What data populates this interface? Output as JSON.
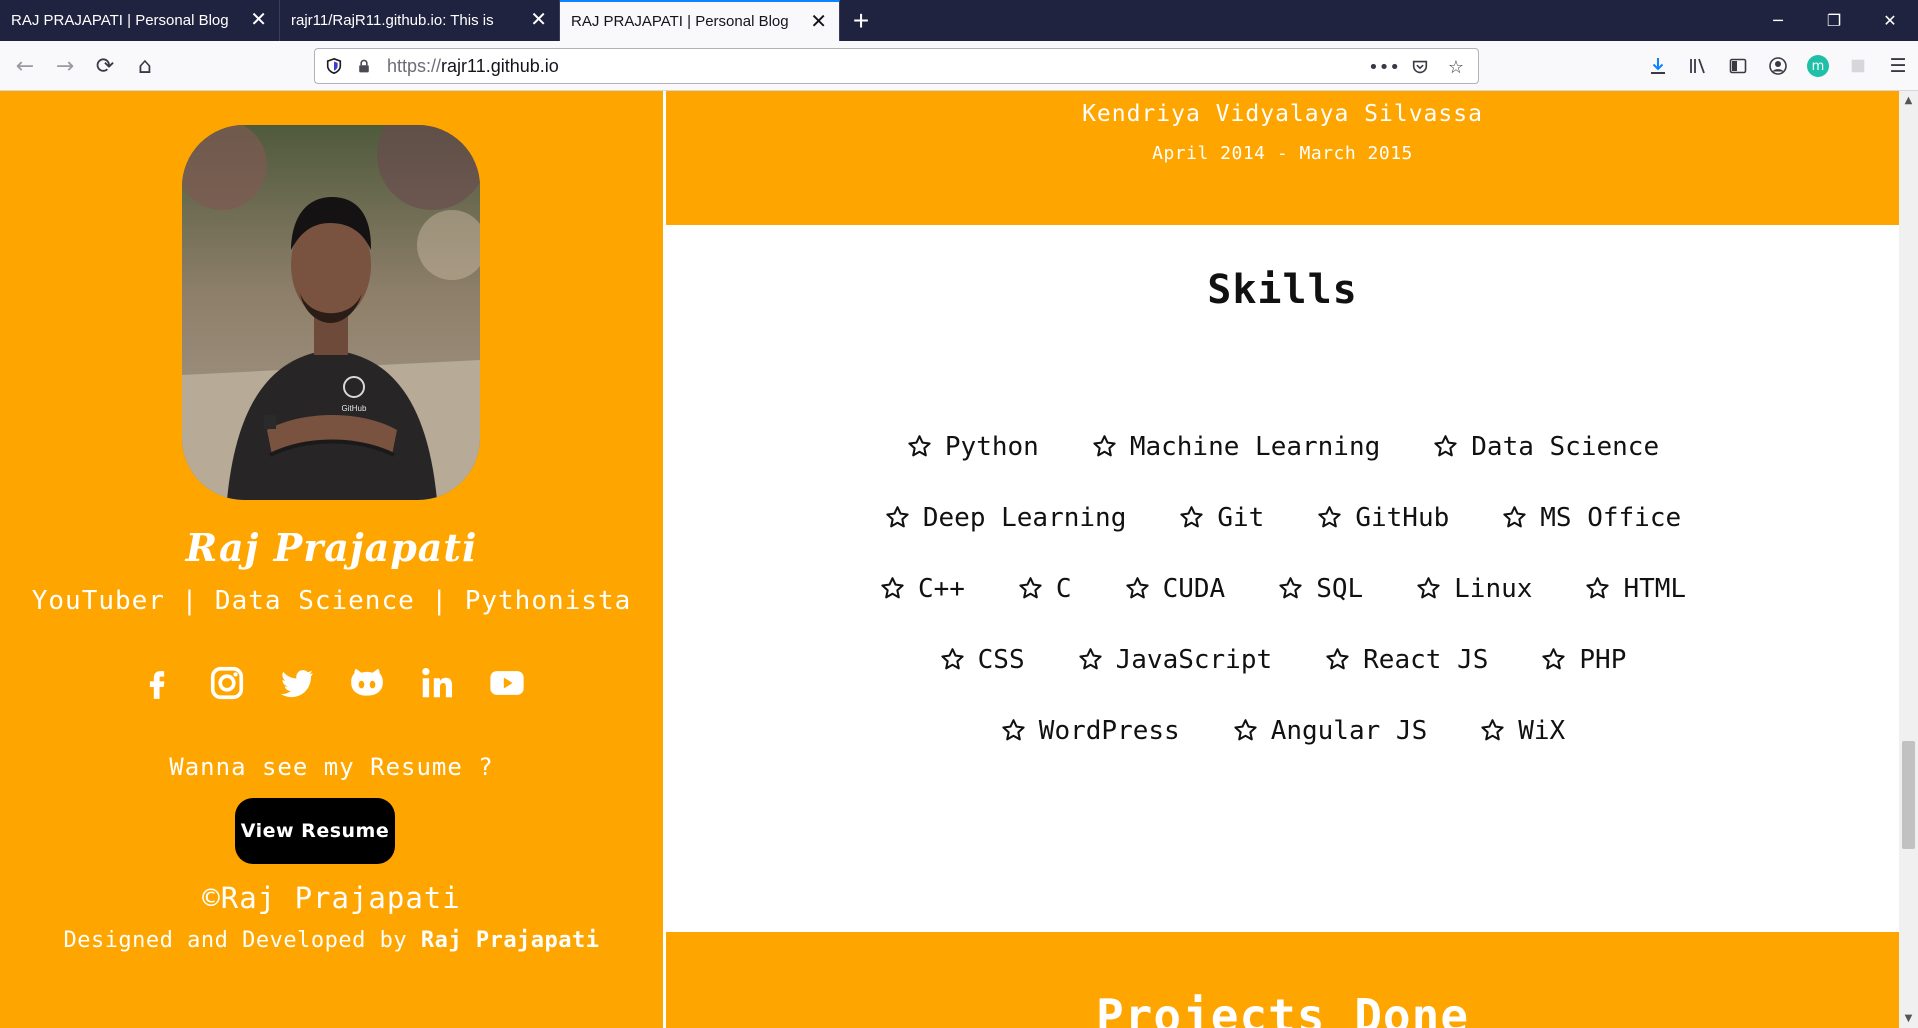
{
  "browser": {
    "tabs": [
      {
        "title": "RAJ PRAJAPATI | Personal Blog",
        "active": false
      },
      {
        "title": "rajr11/RajR11.github.io: This is",
        "active": false
      },
      {
        "title": "RAJ PRAJAPATI | Personal Blog",
        "active": true
      }
    ],
    "url_proto": "https://",
    "url_host": "rajr11.github.io",
    "ext_badge": "m",
    "icons": {
      "new_tab": "plus-icon",
      "back": "back-arrow-icon",
      "forward": "forward-arrow-icon",
      "reload": "reload-icon",
      "home": "home-icon"
    }
  },
  "sidebar": {
    "name": "Raj Prajapati",
    "tagline": "YouTuber | Data Science | Pythonista",
    "socials": [
      "facebook-icon",
      "instagram-icon",
      "twitter-icon",
      "github-icon",
      "linkedin-icon",
      "youtube-icon"
    ],
    "resume_question": "Wanna see my Resume ?",
    "resume_button": "View Resume",
    "copyright": "©Raj Prajapati",
    "credit_prefix": "Designed and Developed by",
    "credit_name": "Raj Prajapati",
    "accent_color": "#ffa500"
  },
  "main": {
    "education": {
      "school": "Kendriya Vidyalaya Silvassa",
      "dates": "April 2014 - March 2015"
    },
    "skills_title": "Skills",
    "skills": [
      "Python",
      "Machine Learning",
      "Data Science",
      "Deep Learning",
      "Git",
      "GitHub",
      "MS Office",
      "C++",
      "C",
      "CUDA",
      "SQL",
      "Linux",
      "HTML",
      "CSS",
      "JavaScript",
      "React JS",
      "PHP",
      "WordPress",
      "Angular JS",
      "WiX"
    ],
    "projects_title": "Projects Done"
  }
}
